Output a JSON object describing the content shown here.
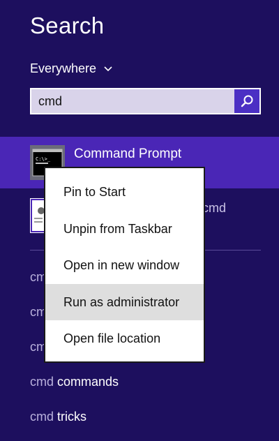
{
  "header": {
    "title": "Search"
  },
  "scope": {
    "label": "Everywhere"
  },
  "search": {
    "value": "cmd"
  },
  "results": [
    {
      "name": "Command Prompt",
      "icon": "command-prompt-icon"
    },
    {
      "name_tail": "cmd",
      "icon": "script-icon"
    }
  ],
  "suggestions": [
    {
      "typed": "cmd",
      "rest": ""
    },
    {
      "typed": "cmd",
      "rest": ""
    },
    {
      "typed": "cmd",
      "rest": ""
    },
    {
      "typed": "cmd",
      "rest": " commands"
    },
    {
      "typed": "cmd",
      "rest": " tricks"
    }
  ],
  "context_menu": {
    "items": [
      {
        "label": "Pin to Start"
      },
      {
        "label": "Unpin from Taskbar"
      },
      {
        "label": "Open in new window"
      },
      {
        "label": "Run as administrator",
        "highlighted": true
      },
      {
        "label": "Open file location"
      }
    ]
  },
  "colors": {
    "background": "#1d0f5e",
    "selected_result": "#4a26b6",
    "search_button": "#4b2fc4",
    "search_field": "#d9d3ea",
    "menu_highlight": "#dedede"
  }
}
